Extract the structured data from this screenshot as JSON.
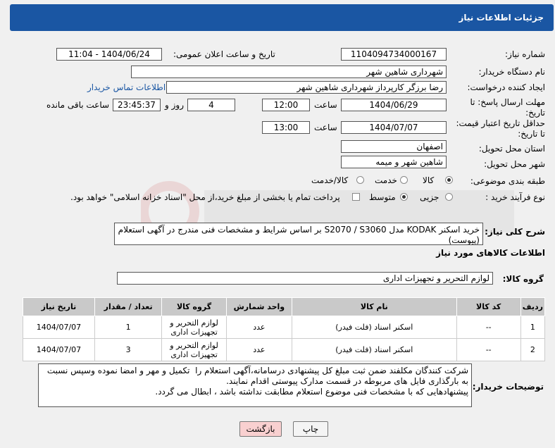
{
  "header": {
    "title": "جزئیات اطلاعات نیاز"
  },
  "fields": {
    "need_number_label": "شماره نیاز:",
    "need_number": "1104094734000167",
    "announce_label": "تاریخ و ساعت اعلان عمومی:",
    "announce_value": "1404/06/24 - 11:04",
    "buyer_org_label": "نام دستگاه خریدار:",
    "buyer_org": "شهرداری شاهین شهر",
    "creator_label": "ایجاد کننده درخواست:",
    "creator": "رضا برزگر کارپرداز شهرداری شاهین شهر",
    "contact_link": "اطلاعات تماس خریدار",
    "deadline_label_1": "مهلت ارسال پاسخ: تا",
    "deadline_label_2": "تاریخ:",
    "deadline_date": "1404/06/29",
    "time_label": "ساعت",
    "deadline_time": "12:00",
    "days_value": "4",
    "days_label": "روز و",
    "remaining_value": "23:45:37",
    "remaining_label": "ساعت باقی مانده",
    "price_label_1": "حداقل تاریخ اعتبار قیمت:",
    "price_label_2": "تا تاریخ:",
    "price_date": "1404/07/07",
    "price_time": "13:00",
    "province_label": "استان محل تحویل:",
    "province": "اصفهان",
    "city_label": "شهر محل تحویل:",
    "city": "شاهین شهر و میمه",
    "category_label": "طبقه بندی موضوعی:",
    "category_options": [
      "کالا",
      "خدمت",
      "کالا/خدمت"
    ],
    "process_label": "نوع فرآیند خرید :",
    "process_options": [
      "جزیی",
      "متوسط"
    ],
    "payment_note": "پرداخت تمام یا بخشی از مبلغ خرید،از محل \"اسناد خزانه اسلامی\" خواهد بود.",
    "description_label": "شرح کلی نیاز:",
    "description": "خرید اسکنر KODAK مدل S2070 / S3060 بر اساس شرایط و مشخصات فنی مندرج در آگهی استعلام (پیوست)",
    "items_info_title": "اطلاعات کالاهای مورد نیاز",
    "goods_group_label": "گروه کالا:",
    "goods_group": "لوازم التحریر و تجهیزات اداری",
    "buyer_notes_label": "توضیحات خریدار:",
    "buyer_notes": "شرکت کنندگان مکلفند ضمن ثبت مبلغ کل پیشنهادی درسامانه،آگهی استعلام را  تکمیل و مهر و امضا نموده وسپس نسبت به بارگذاری فایل های مربوطه در قسمت مدارک پیوستی اقدام نمایند.\nپیشنهادهایی که با مشخصات فنی موضوع استعلام مطابقت نداشته باشد ، ابطال می گردد."
  },
  "table": {
    "headers": [
      "ردیف",
      "کد کالا",
      "نام کالا",
      "واحد شمارش",
      "گروه کالا",
      "تعداد / مقدار",
      "تاریخ نیاز"
    ],
    "rows": [
      [
        "1",
        "--",
        "اسکنر اسناد (فلت فیدر)",
        "عدد",
        "لوازم التحریر و تجهیزات اداری",
        "1",
        "1404/07/07"
      ],
      [
        "2",
        "--",
        "اسکنر اسناد (فلت فیدر)",
        "عدد",
        "لوازم التحریر و تجهیزات اداری",
        "3",
        "1404/07/07"
      ]
    ]
  },
  "buttons": {
    "print": "چاپ",
    "back": "بازگشت"
  },
  "colors": {
    "header_bg": "#1a56a3",
    "link": "#1a56a3",
    "back_button_bg": "#f9d0d0"
  }
}
